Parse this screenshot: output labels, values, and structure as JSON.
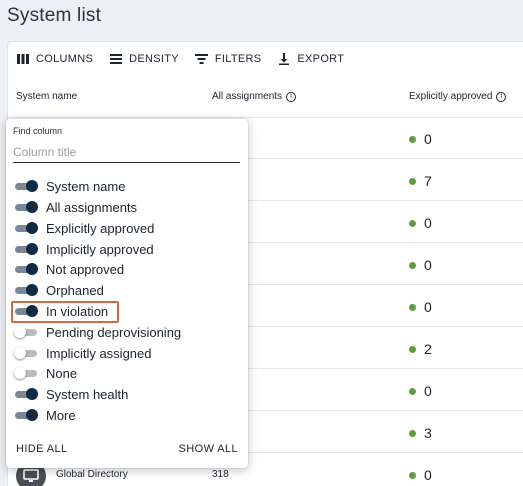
{
  "page": {
    "title": "System list"
  },
  "toolbar": {
    "columns_label": "COLUMNS",
    "density_label": "DENSITY",
    "filters_label": "FILTERS",
    "export_label": "EXPORT"
  },
  "table": {
    "headers": {
      "system_name": "System name",
      "all_assignments": "All assignments",
      "explicitly_approved": "Explicitly approved"
    },
    "rows": [
      {
        "explicitly_approved": "0"
      },
      {
        "explicitly_approved": "7"
      },
      {
        "explicitly_approved": "0"
      },
      {
        "explicitly_approved": "0"
      },
      {
        "explicitly_approved": "0"
      },
      {
        "explicitly_approved": "2"
      },
      {
        "explicitly_approved": "0"
      },
      {
        "explicitly_approved": "3"
      },
      {
        "system_name": "Global Directory",
        "all_assignments": "318",
        "explicitly_approved": "0"
      }
    ]
  },
  "columns_panel": {
    "find_label": "Find column",
    "find_placeholder": "Column title",
    "columns": [
      {
        "label": "System name",
        "on": true
      },
      {
        "label": "All assignments",
        "on": true
      },
      {
        "label": "Explicitly approved",
        "on": true
      },
      {
        "label": "Implicitly approved",
        "on": true
      },
      {
        "label": "Not approved",
        "on": true
      },
      {
        "label": "Orphaned",
        "on": true
      },
      {
        "label": "In violation",
        "on": true
      },
      {
        "label": "Pending deprovisioning",
        "on": false
      },
      {
        "label": "Implicitly assigned",
        "on": false
      },
      {
        "label": "None",
        "on": false
      },
      {
        "label": "System health",
        "on": true
      },
      {
        "label": "More",
        "on": true
      }
    ],
    "hide_all_label": "HIDE ALL",
    "show_all_label": "SHOW ALL"
  },
  "colors": {
    "status_green": "#58a03e",
    "switch_on": "#0e2a44",
    "highlight": "#d06a45"
  }
}
